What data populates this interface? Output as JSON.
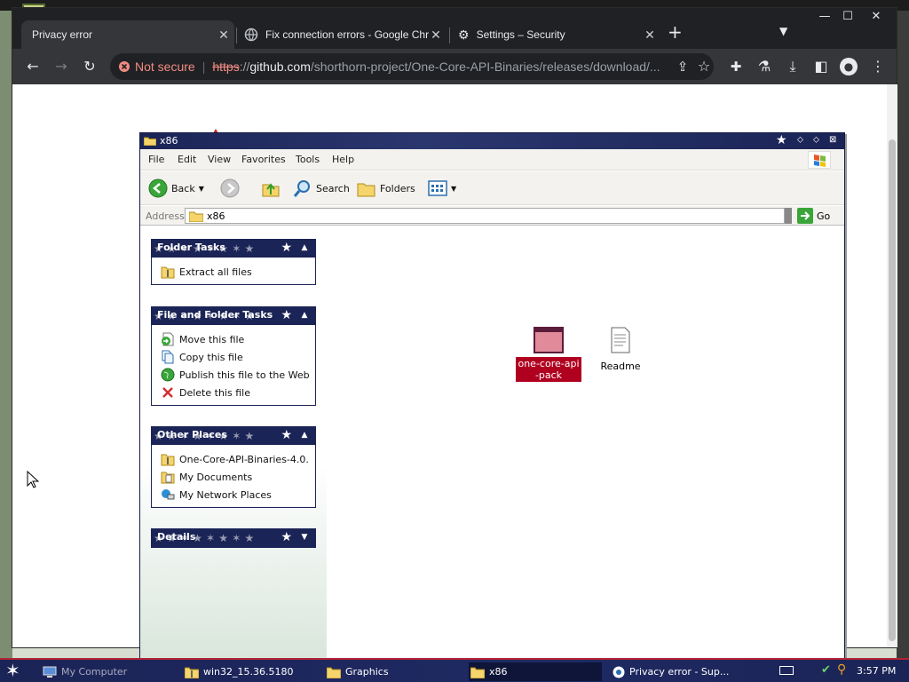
{
  "browser": {
    "tabs": [
      {
        "title": "Privacy error"
      },
      {
        "title": "Fix connection errors - Google Chrome Help"
      },
      {
        "title": "Settings – Security"
      }
    ],
    "security_label": "Not secure",
    "url_scheme": "https",
    "url_sep": "://",
    "url_host": "github.com",
    "url_path": "/shorthorn-project/One-Core-API-Binaries/releases/download/..."
  },
  "explorer": {
    "title": "x86",
    "menus": [
      "File",
      "Edit",
      "View",
      "Favorites",
      "Tools",
      "Help"
    ],
    "toolbar": {
      "back": "Back",
      "search": "Search",
      "folders": "Folders"
    },
    "address_label": "Address",
    "address_value": "x86",
    "go_label": "Go",
    "panels": {
      "folder_tasks": {
        "title": "Folder Tasks",
        "items": [
          "Extract all files"
        ]
      },
      "file_tasks": {
        "title": "File and Folder Tasks",
        "items": [
          "Move this file",
          "Copy this file",
          "Publish this file to the Web",
          "Delete this file"
        ]
      },
      "other_places": {
        "title": "Other Places",
        "items": [
          "One-Core-API-Binaries-4.0.",
          "My Documents",
          "My Network Places"
        ]
      },
      "details": {
        "title": "Details"
      }
    },
    "files": [
      {
        "name": "one-core-api-pack"
      },
      {
        "name": "Readme"
      }
    ]
  },
  "taskbar": {
    "items": [
      "My Computer",
      "win32_15.36.5180",
      "Graphics",
      "x86",
      "Privacy error - Sup..."
    ],
    "clock": "3:57 PM"
  },
  "colors": {
    "selection": "#b00020",
    "xp_navy": "#1b2456",
    "chrome_dark": "#202124"
  }
}
